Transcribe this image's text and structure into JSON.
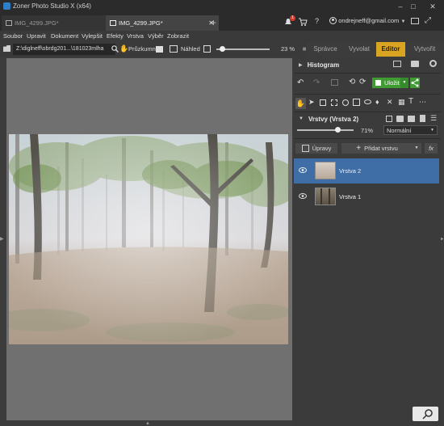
{
  "app": {
    "title": "Zoner Photo Studio X (x64)"
  },
  "tabs": [
    {
      "label": "IMG_4299.JPG*"
    },
    {
      "label": "IMG_4299.JPG*"
    }
  ],
  "header": {
    "notification_count": "1",
    "help": "?",
    "account": "ondrejneff@gmail.com"
  },
  "menu": [
    "Soubor",
    "Upravit",
    "Dokument",
    "Vylepšit",
    "Efekty",
    "Vrstva",
    "Výběr",
    "Zobrazit"
  ],
  "modules": {
    "manager": "Správce",
    "develop": "Vyvolat",
    "editor": "Editor",
    "create": "Vytvořit"
  },
  "pathbar": {
    "path": "Z:\\diglneff\\obrdg201...\\181023mlha",
    "explorer": "Průzkumník",
    "preview": "Náhled",
    "zoom": "23 %",
    "zoom_level": 0.1
  },
  "histogram": {
    "title": "Histogram"
  },
  "save": {
    "label": "Uložit"
  },
  "layers": {
    "title": "Vrstvy (Vrstva 2)",
    "opacity_text": "71%",
    "opacity": 0.71,
    "blend_mode": "Normální",
    "adjust_label": "Úpravy",
    "add_layer_label": "Přidat vrstvu",
    "fx_label": "fx",
    "items": [
      {
        "name": "Vrstva 2",
        "selected": true
      },
      {
        "name": "Vrstva 1",
        "selected": false
      }
    ]
  },
  "colors": {
    "accent": "#d9a422",
    "selected_layer": "#3f6ea6",
    "save_green": "#3f9b32"
  }
}
